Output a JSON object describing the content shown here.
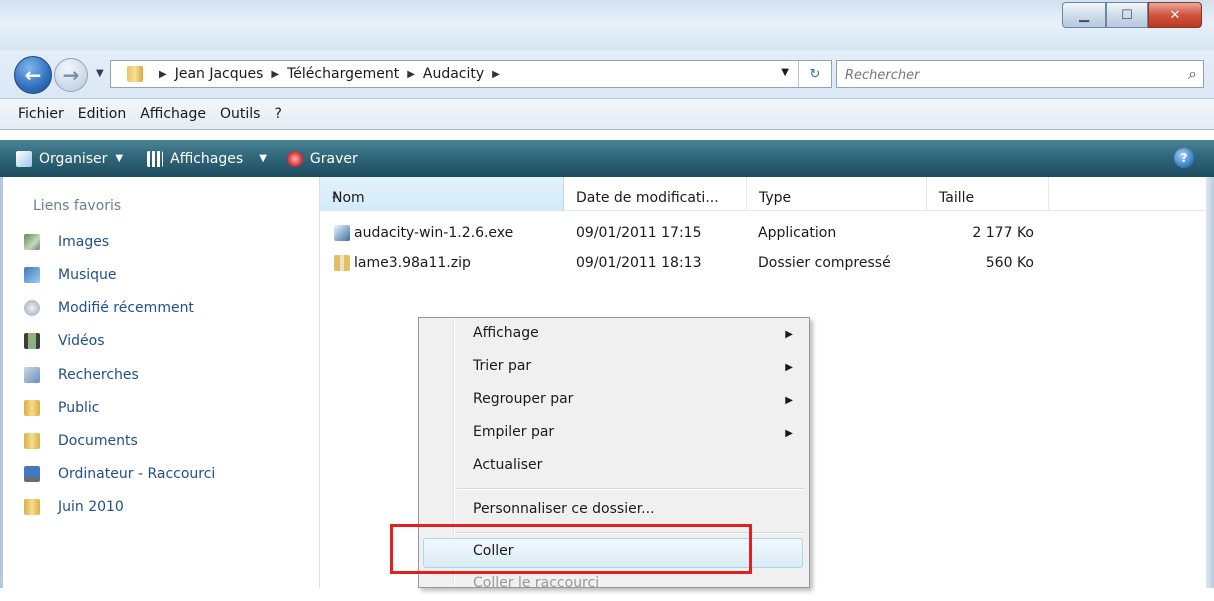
{
  "window": {
    "minimize_icon": "minimize-icon",
    "maximize_icon": "maximize-icon",
    "close_icon": "close-icon"
  },
  "address": {
    "breadcrumbs": [
      "Jean Jacques",
      "Téléchargement",
      "Audacity"
    ],
    "search_placeholder": "Rechercher"
  },
  "menubar": {
    "items": [
      "Fichier",
      "Edition",
      "Affichage",
      "Outils",
      "?"
    ]
  },
  "commandbar": {
    "organize": "Organiser",
    "views": "Affichages",
    "burn": "Graver"
  },
  "sidebar": {
    "title": "Liens favoris",
    "items": [
      {
        "label": "Images",
        "icon": "images-icon"
      },
      {
        "label": "Musique",
        "icon": "music-icon"
      },
      {
        "label": "Modifié récemment",
        "icon": "recent-icon"
      },
      {
        "label": "Vidéos",
        "icon": "video-icon"
      },
      {
        "label": "Recherches",
        "icon": "search-folder-icon"
      },
      {
        "label": "Public",
        "icon": "folder-icon"
      },
      {
        "label": "Documents",
        "icon": "folder-icon"
      },
      {
        "label": "Ordinateur - Raccourci",
        "icon": "computer-icon"
      },
      {
        "label": "Juin 2010",
        "icon": "folder-icon"
      }
    ]
  },
  "files": {
    "columns": [
      "Nom",
      "Date de modificati...",
      "Type",
      "Taille"
    ],
    "rows": [
      {
        "name": "audacity-win-1.2.6.exe",
        "date": "09/01/2011 17:15",
        "type": "Application",
        "size": "2 177 Ko",
        "icon": "exe-icon"
      },
      {
        "name": "lame3.98a11.zip",
        "date": "09/01/2011 18:13",
        "type": "Dossier compressé",
        "size": "560 Ko",
        "icon": "zip-icon"
      }
    ]
  },
  "context_menu": {
    "items": [
      {
        "label": "Affichage"
      },
      {
        "label": "Trier par"
      },
      {
        "label": "Regrouper par"
      },
      {
        "label": "Empiler par"
      },
      {
        "label": "Actualiser"
      },
      {
        "label": "Personnaliser ce dossier..."
      },
      {
        "label": "Coller"
      },
      {
        "label": "Coller le raccourci"
      }
    ]
  },
  "colors": {
    "highlight_box": "#e2201f",
    "link": "#1f4f8c",
    "commandbar": "#2f6478"
  }
}
